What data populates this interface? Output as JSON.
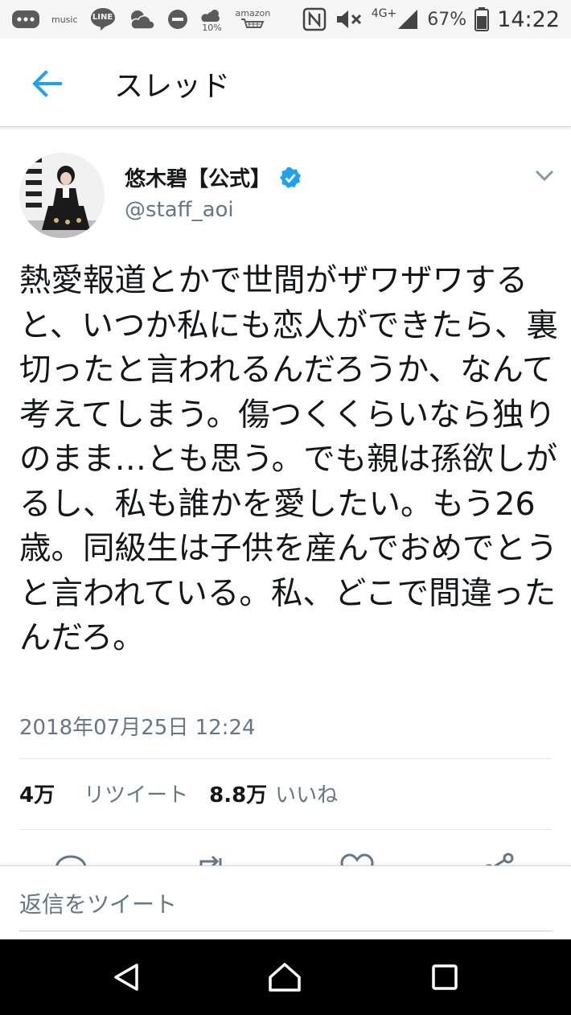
{
  "status_bar": {
    "left_icons": [
      "menu-dots-icon",
      "amazon-music-icon",
      "line-icon",
      "weather-cloud-icon",
      "do-not-disturb-icon",
      "weather-sun-icon",
      "amazon-icon"
    ],
    "music_label": "music",
    "line_label": "LINE",
    "weather_percent": "10%",
    "amazon_label": "amazon",
    "network": "4G+",
    "battery_percent": "67%",
    "time": "14:22"
  },
  "app_bar": {
    "title": "スレッド",
    "back_icon": "arrow-back-icon",
    "accent_color": "#1da1f2"
  },
  "tweet": {
    "display_name": "悠木碧【公式】",
    "verified": true,
    "handle": "@staff_aoi",
    "text": "熱愛報道とかで世間がザワザワすると、いつか私にも恋人ができたら、裏切ったと言われるんだろうか、なんて考えてしまう。傷つくくらいなら独りのまま…とも思う。でも親は孫欲しがるし、私も誰かを愛したい。もう26歳。同級生は子供を産んでおめでとうと言われている。私、どこで間違ったんだろ。",
    "timestamp": "2018年07月25日 12:24",
    "retweet_count": "4万",
    "retweet_label": "リツイート",
    "like_count": "8.8万",
    "like_label": "いいね"
  },
  "actions": [
    "reply-icon",
    "retweet-icon",
    "like-icon",
    "share-icon"
  ],
  "reply_bar": {
    "placeholder": "返信をツイート"
  },
  "nav_bar": {
    "buttons": [
      "back-triangle-icon",
      "home-icon",
      "recents-icon"
    ]
  },
  "colors": {
    "verified_badge": "#1da1f2",
    "secondary_text": "#657786"
  }
}
